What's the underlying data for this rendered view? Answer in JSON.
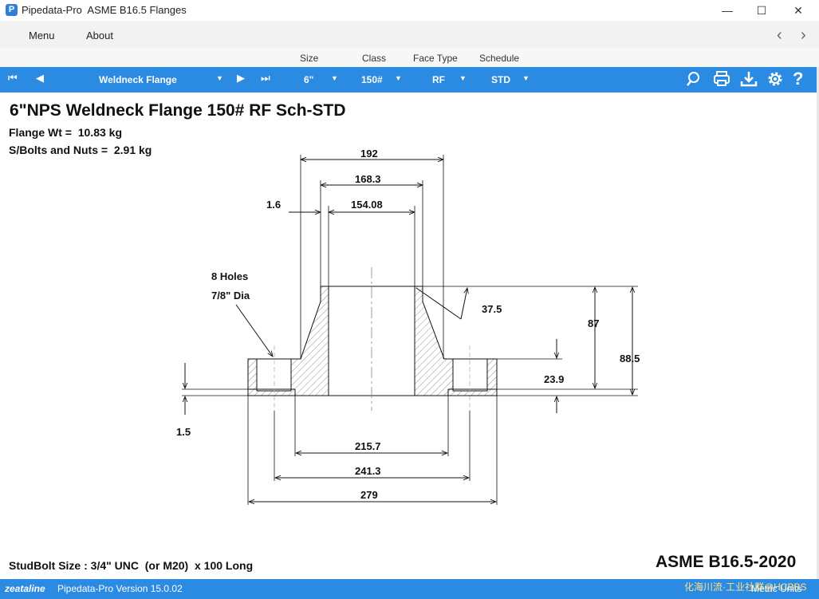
{
  "window": {
    "app_name": "Pipedata-Pro",
    "title": "ASME B16.5 Flanges",
    "minimize": "—",
    "maximize": "☐",
    "close": "✕"
  },
  "menu": {
    "menu_label": "Menu",
    "about_label": "About",
    "back_icon": "chevron-left-icon",
    "forward_icon": "chevron-right-icon"
  },
  "columns": {
    "size": "Size",
    "class": "Class",
    "face_type": "Face Type",
    "schedule": "Schedule"
  },
  "toolbar": {
    "flange_type": "Weldneck Flange",
    "size": "6\"",
    "class": "150#",
    "face_type": "RF",
    "schedule": "STD",
    "icons": [
      "search-icon",
      "print-icon",
      "download-icon",
      "settings-icon",
      "help-icon"
    ],
    "accent": "#2b8ae2"
  },
  "main": {
    "heading": "6\"NPS Weldneck Flange 150# RF Sch-STD",
    "flange_wt_label": "Flange Wt =",
    "flange_wt_value": "10.83 kg",
    "bolts_label": "S/Bolts and Nuts =",
    "bolts_value": "2.91 kg",
    "studbolt": "StudBolt Size : 3/4\" UNC  (or M20)  x 100 Long",
    "standard": "ASME B16.5-2020"
  },
  "drawing": {
    "holes_count": "8 Holes",
    "holes_dia": "7/8\" Dia",
    "dims": {
      "hub_od": "192",
      "pipe_od": "168.3",
      "bore": "154.08",
      "wall_step": "1.6",
      "hub_angle": "37.5",
      "length_thru_hub": "87",
      "overall_height": "88.5",
      "flange_thk": "23.9",
      "raised_face_thk": "1.5",
      "raised_face_dia": "215.7",
      "bolt_circle": "241.3",
      "flange_od": "279"
    }
  },
  "status": {
    "brand": "zeataline",
    "version": "Pipedata-Pro Version 15.0.02",
    "units": "Metric Units",
    "watermark": "化海川流·工业社群@HCBBS"
  }
}
